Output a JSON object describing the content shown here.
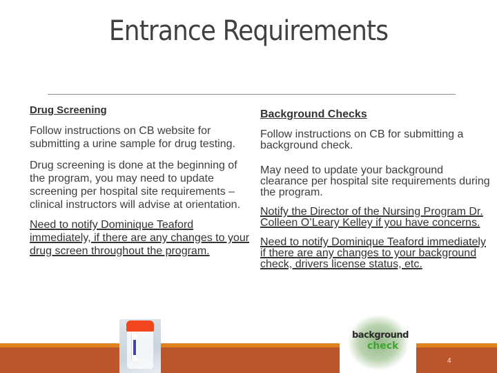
{
  "slide": {
    "title": "Entrance Requirements",
    "page_number": "4"
  },
  "left_column": {
    "heading": "Drug Screening",
    "paragraphs": [
      "Follow instructions on CB website for submitting a urine sample for drug testing.",
      "Drug screening is done at the beginning of the program, you may need to update screening per hospital site requirements – clinical instructors will advise at orientation.",
      "Need to notify Dominique Teaford immediately, if there are any changes to your drug screen throughout the program."
    ]
  },
  "right_column": {
    "heading": "Background Checks",
    "paragraphs": [
      "Follow instructions on CB for submitting a background check.",
      "May need to update your background clearance per hospital site requirements during the program.",
      "Notify the Director of the Nursing Program Dr. Colleen O’Leary Kelley if you have concerns.",
      "Need to notify Dominique Teaford immediately if there are any changes to your background check, drivers license status, etc."
    ]
  },
  "images": {
    "cup": "urine-specimen-cup-photo",
    "cloud": "background-check-word-cloud",
    "cloud_words": [
      "background",
      "check"
    ]
  },
  "colors": {
    "footer_stripe": "#e0821d",
    "footer_band": "#bb552a",
    "cloud_accent": "#3ca42f"
  }
}
